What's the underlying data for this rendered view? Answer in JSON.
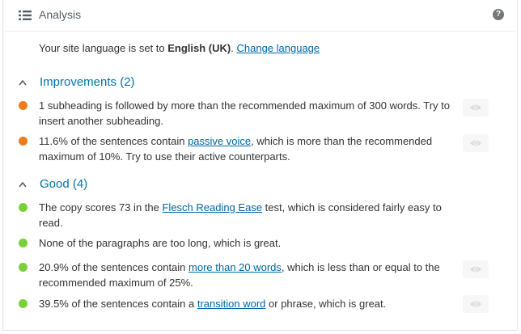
{
  "header": {
    "title": "Analysis",
    "help_glyph": "?",
    "icons": {
      "list": "list-icon",
      "help": "help-icon"
    }
  },
  "language": {
    "prefix": "Your site language is set to ",
    "language_name": "English (UK)",
    "suffix": ". ",
    "change_link": "Change language"
  },
  "improvements": {
    "heading": "Improvements (2)",
    "items": [
      {
        "text": "1 subheading is followed by more than the recommended maximum of 300 words. Try to insert another subheading."
      },
      {
        "before": "11.6% of the sentences contain ",
        "link": "passive voice",
        "after": ", which is more than the recommended maximum of 10%. Try to use their active counterparts."
      }
    ]
  },
  "good": {
    "heading": "Good (4)",
    "items": [
      {
        "before": "The copy scores 73 in the ",
        "link": "Flesch Reading Ease",
        "after": " test, which is considered fairly easy to read."
      },
      {
        "text": "None of the paragraphs are too long, which is great."
      },
      {
        "before": "20.9% of the sentences contain ",
        "link": "more than 20 words",
        "after": ", which is less than or equal to the recommended maximum of 25%."
      },
      {
        "before": "39.5% of the sentences contain a ",
        "link": "transition word",
        "after": " or phrase, which is great."
      }
    ]
  },
  "colors": {
    "improvement_bullet": "#ee7c1b",
    "good_bullet": "#7ad03a",
    "heading": "#0073aa",
    "link": "#0066a5"
  }
}
